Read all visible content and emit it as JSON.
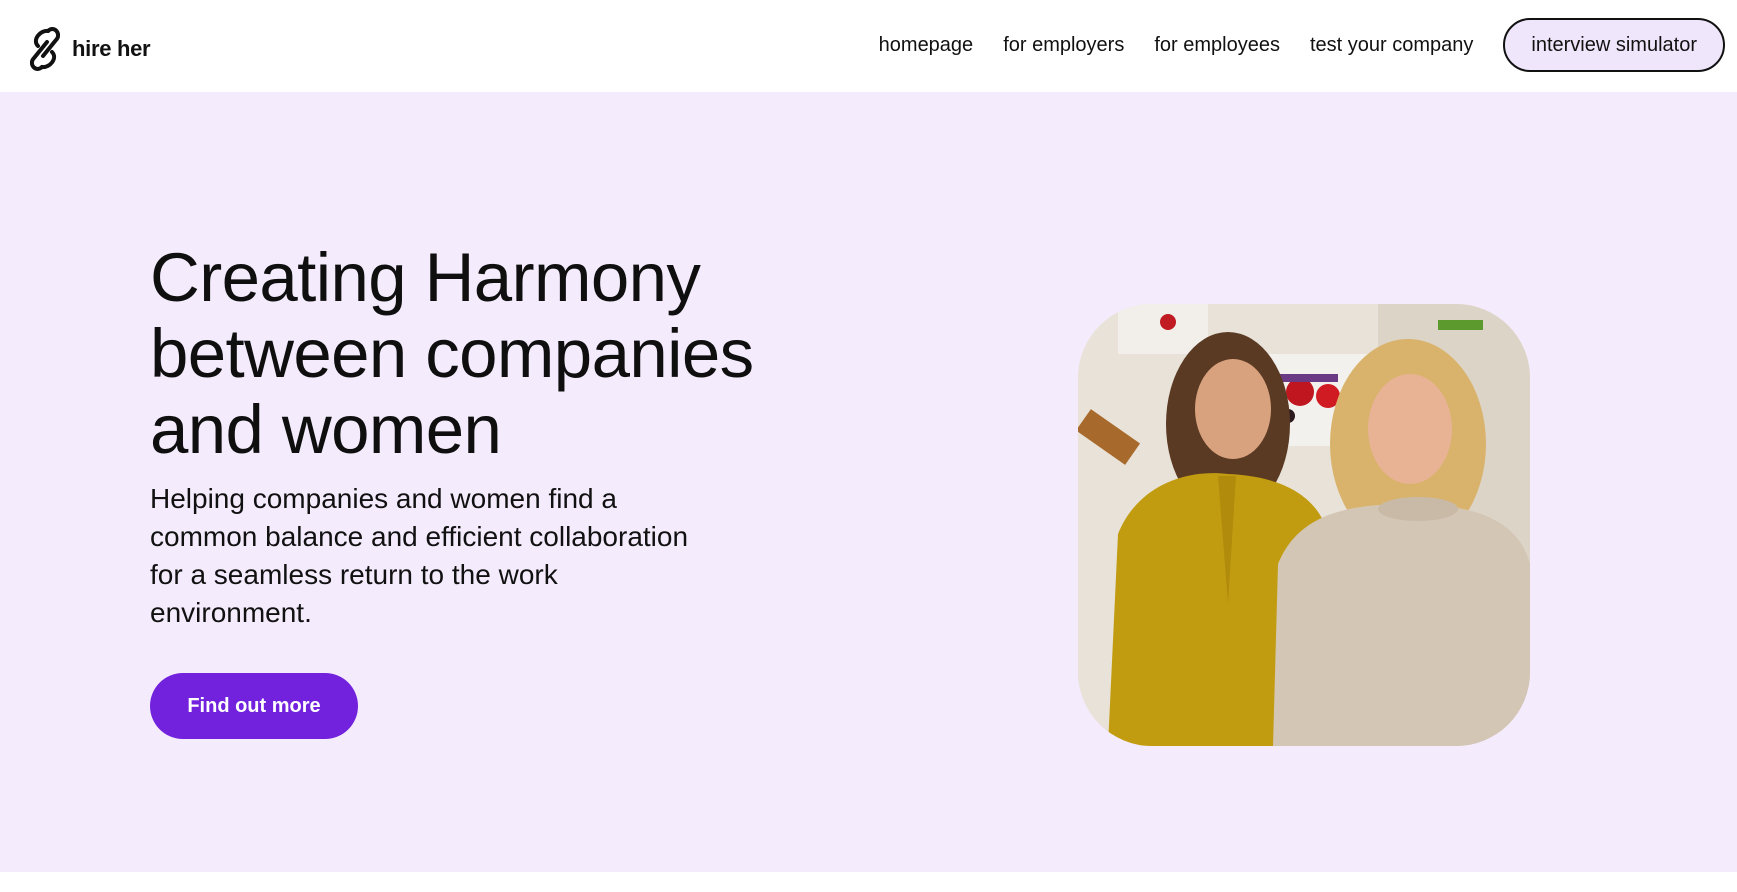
{
  "header": {
    "logo_text": "hire her",
    "logo_icon": "chain-link-icon",
    "nav_links": [
      {
        "label": "homepage"
      },
      {
        "label": "for employers"
      },
      {
        "label": "for employees"
      },
      {
        "label": "test your company"
      }
    ],
    "cta_label": "interview simulator"
  },
  "hero": {
    "title": "Creating Harmony between companies and women",
    "subtitle": "Helping companies and women find a common balance and efficient collaboration for a seamless return to the work environment.",
    "button_label": "Find out more",
    "image_description_icon": "two-women-photo"
  },
  "colors": {
    "hero_background": "#f4ebfc",
    "cta_background": "#efe6fb",
    "primary_button": "#7221dd",
    "text": "#111111"
  }
}
